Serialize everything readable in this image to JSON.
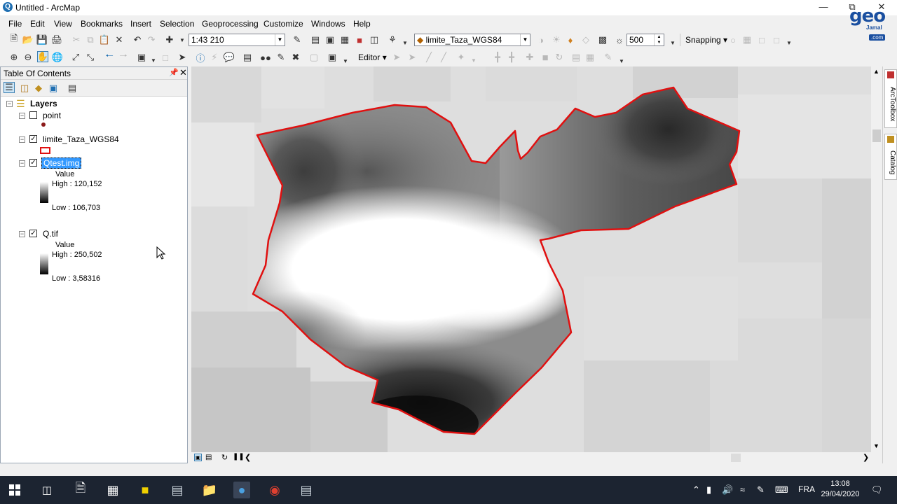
{
  "window": {
    "title": "Untitled - ArcMap",
    "app_icon_glyph": "Q"
  },
  "logo": {
    "text": "geo",
    "sub": "Jamal",
    "domain": ".com"
  },
  "menu": [
    "File",
    "Edit",
    "View",
    "Bookmarks",
    "Insert",
    "Selection",
    "Geoprocessing",
    "Customize",
    "Windows",
    "Help"
  ],
  "toolbar": {
    "scale": "1:43 210",
    "layer_combo": "limite_Taza_WGS84",
    "zoom_value": "500",
    "snapping_label": "Snapping",
    "editor_label": "Editor"
  },
  "toc": {
    "title": "Table Of Contents",
    "root_label": "Layers",
    "layers": [
      {
        "name": "point",
        "checked": false
      },
      {
        "name": "limite_Taza_WGS84",
        "checked": true
      },
      {
        "name": "Qtest.img",
        "checked": true,
        "legend_title": "Value",
        "high": "High : 120,152",
        "low": "Low : 106,703"
      },
      {
        "name": "Q.tif",
        "checked": true,
        "legend_title": "Value",
        "high": "High : 250,502",
        "low": "Low : 3,58316"
      }
    ]
  },
  "dock_tabs": [
    "ArcToolbox",
    "Catalog"
  ],
  "taskbar": {
    "language": "FRA",
    "time": "13:08",
    "date": "29/04/2020"
  },
  "colors": {
    "boundary": "#e01010",
    "selection": "#3399ff",
    "taskbar": "#1c2431"
  }
}
